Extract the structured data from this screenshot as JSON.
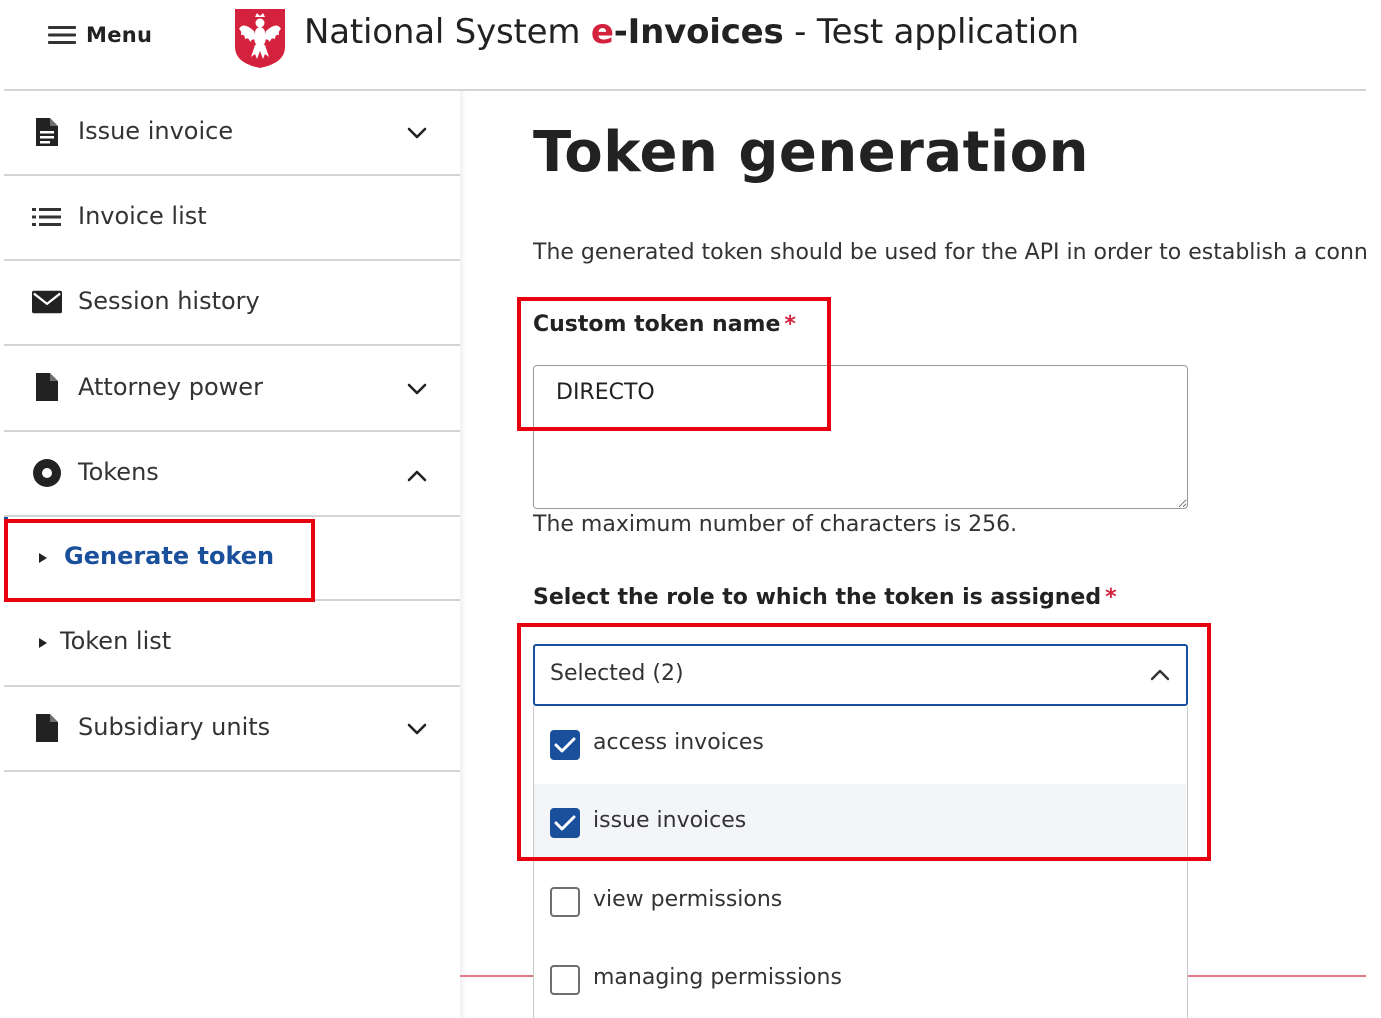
{
  "header": {
    "menu_label": "Menu",
    "title_prefix": "National System",
    "brand_e": "e",
    "brand_rest": "-Invoices",
    "title_suffix": " - Test application",
    "brand_color": "#d4213d"
  },
  "sidebar": {
    "items": [
      {
        "label": "Issue invoice",
        "icon": "file-icon",
        "chevron": "down"
      },
      {
        "label": "Invoice list",
        "icon": "list-icon"
      },
      {
        "label": "Session history",
        "icon": "envelope-icon"
      },
      {
        "label": "Attorney power",
        "icon": "document-icon",
        "chevron": "down"
      },
      {
        "label": "Tokens",
        "icon": "disc-icon",
        "chevron": "up",
        "expanded": true
      },
      {
        "label": "Generate token",
        "sub": true,
        "active": true
      },
      {
        "label": "Token list",
        "sub": true
      },
      {
        "label": "Subsidiary units",
        "icon": "document-icon",
        "chevron": "down"
      }
    ],
    "active_color": "#1a4f9c"
  },
  "main": {
    "title": "Token generation",
    "description": "The generated token should be used for the API in order to establish a connection",
    "token_name": {
      "label": "Custom token name",
      "required_mark": "*",
      "value": "DIRECTO",
      "help": "The maximum number of characters is 256."
    },
    "role": {
      "label": "Select the role to which the token is assigned",
      "required_mark": "*",
      "selected_text": "Selected (2)",
      "options": [
        {
          "label": "access invoices",
          "checked": true
        },
        {
          "label": "issue invoices",
          "checked": true
        },
        {
          "label": "view permissions",
          "checked": false
        },
        {
          "label": "managing permissions",
          "checked": false
        }
      ]
    }
  },
  "annotation_color": "#e8000f"
}
